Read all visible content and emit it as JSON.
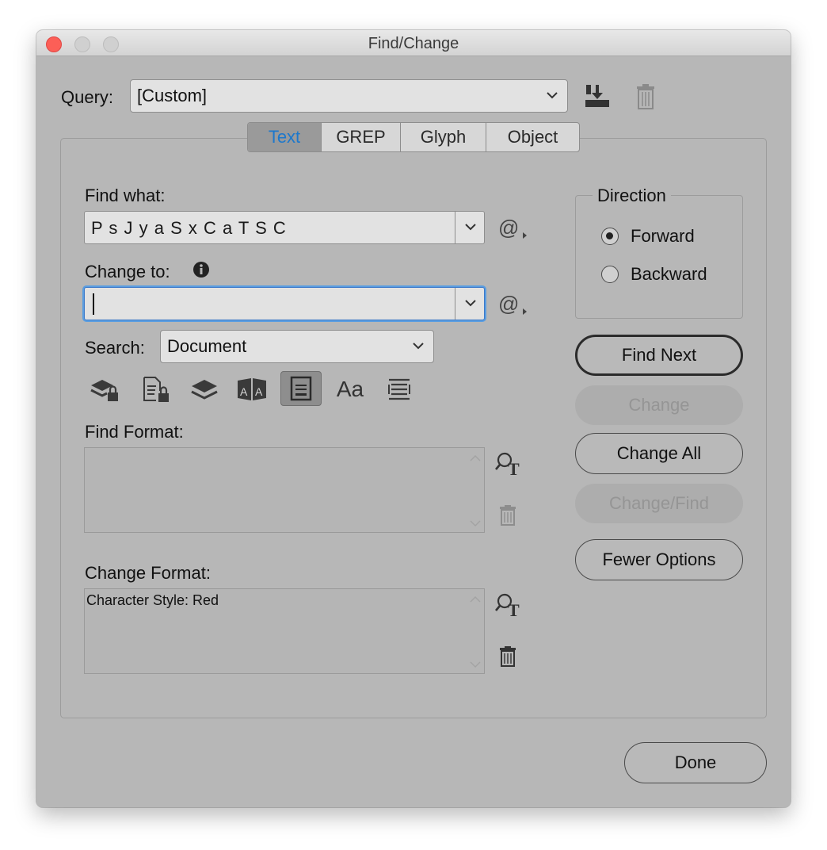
{
  "window": {
    "title": "Find/Change"
  },
  "query": {
    "label": "Query:",
    "value": "[Custom]"
  },
  "tabs": [
    {
      "label": "Text",
      "active": true
    },
    {
      "label": "GREP",
      "active": false
    },
    {
      "label": "Glyph",
      "active": false
    },
    {
      "label": "Object",
      "active": false
    }
  ],
  "find": {
    "label": "Find what:",
    "value": "P s J y a S x C a T S C"
  },
  "change": {
    "label": "Change to:",
    "value": ""
  },
  "search": {
    "label": "Search:",
    "value": "Document"
  },
  "find_format": {
    "label": "Find Format:",
    "value": ""
  },
  "change_format": {
    "label": "Change Format:",
    "value": "Character Style: Red"
  },
  "direction": {
    "label": "Direction",
    "options": [
      {
        "label": "Forward",
        "selected": true
      },
      {
        "label": "Backward",
        "selected": false
      }
    ]
  },
  "buttons": {
    "find_next": "Find Next",
    "change": "Change",
    "change_all": "Change All",
    "change_find": "Change/Find",
    "fewer_options": "Fewer Options",
    "done": "Done"
  },
  "options_icons": [
    "include-locked-layers-icon",
    "include-locked-stories-icon",
    "include-hidden-layers-icon",
    "include-master-pages-icon",
    "include-footnotes-icon",
    "case-sensitive-icon",
    "whole-word-icon"
  ],
  "option_glyphs": {
    "case": "Aa"
  },
  "colors": {
    "active_tab_text": "#1d78cc",
    "focus_ring": "#5a9de0",
    "close_button": "#fc5f57"
  }
}
